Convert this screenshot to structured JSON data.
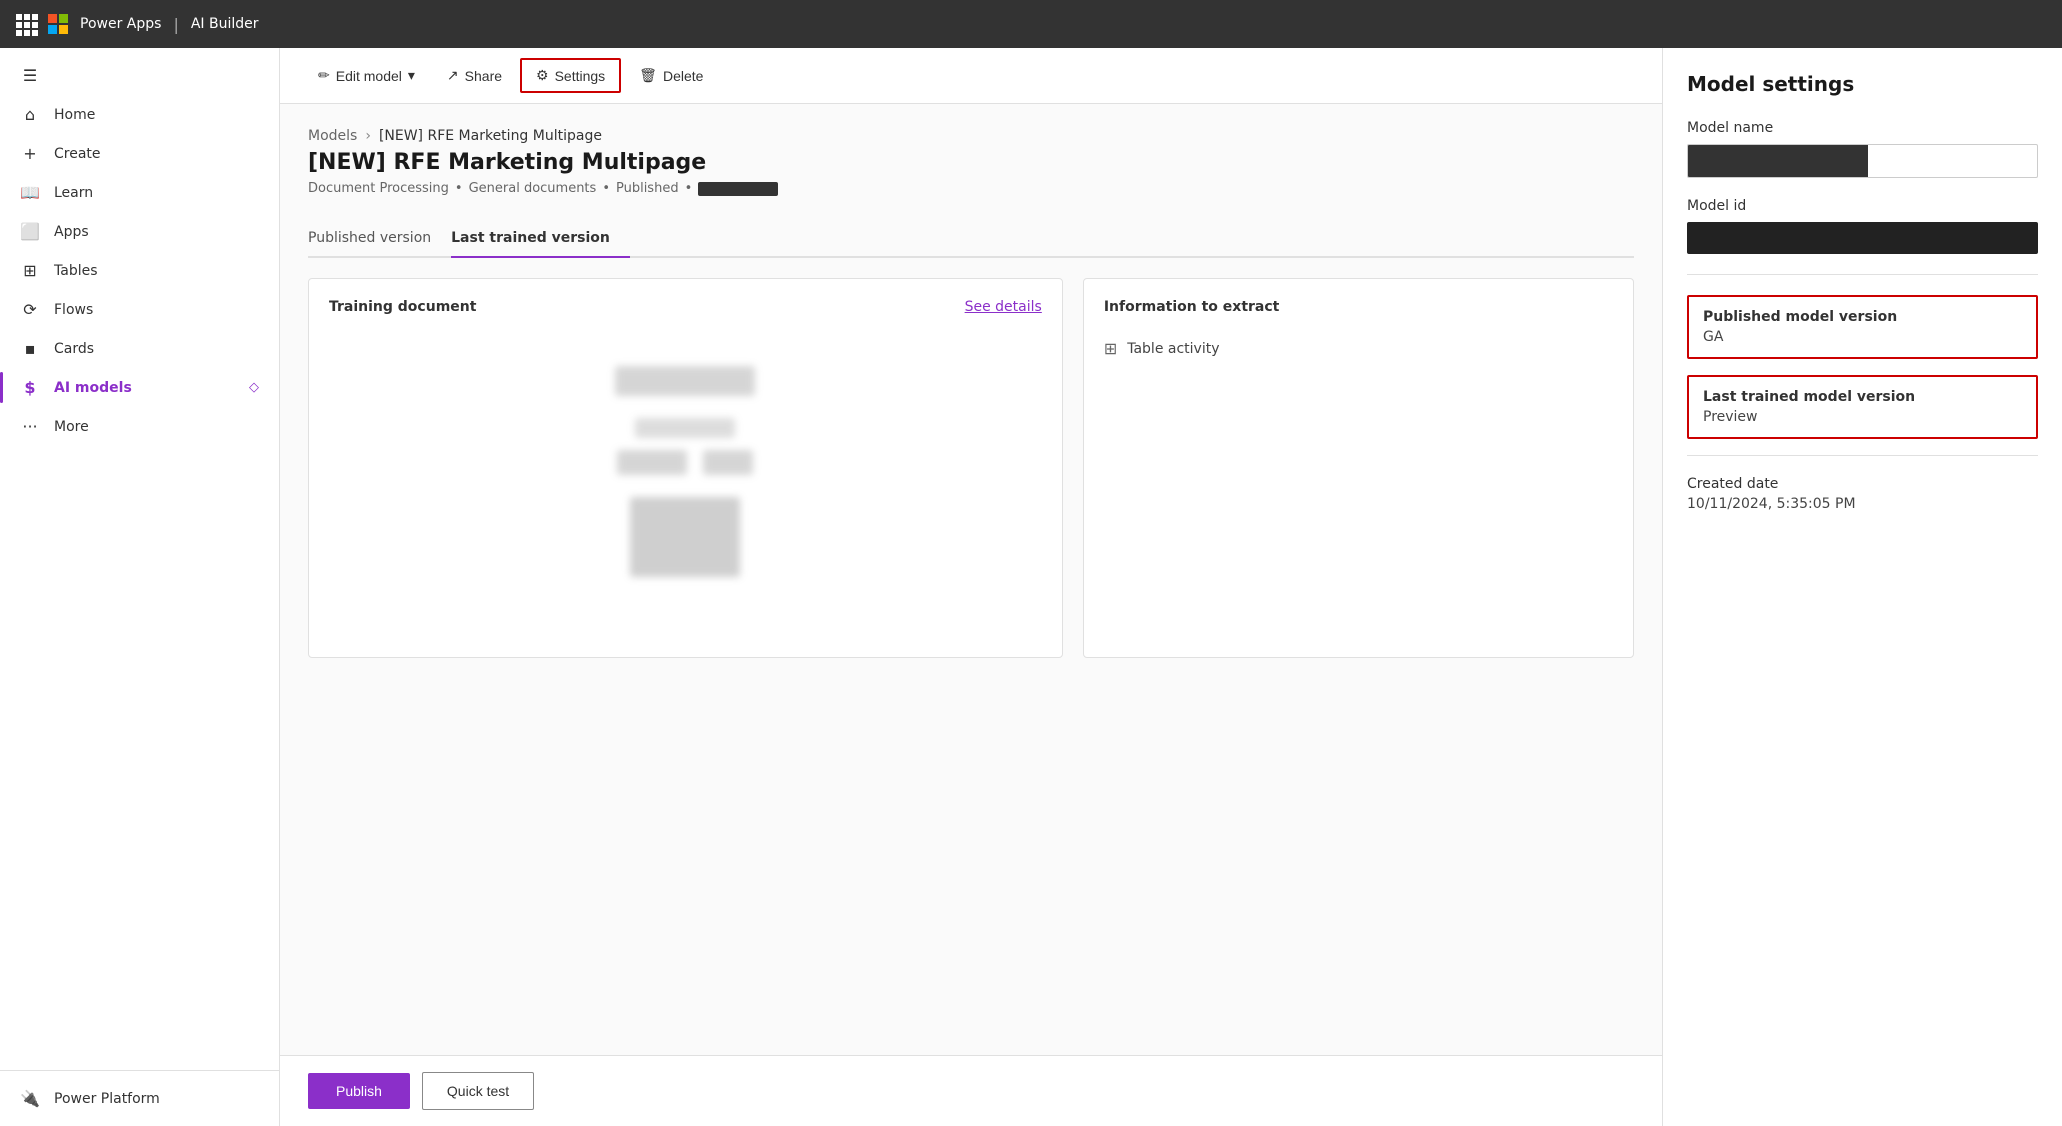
{
  "topbar": {
    "waffle_label": "Apps",
    "ms_logo_alt": "Microsoft logo",
    "brand": "Power Apps",
    "separator": "|",
    "product": "AI Builder"
  },
  "sidebar": {
    "hamburger": "☰",
    "items": [
      {
        "id": "home",
        "label": "Home",
        "icon": "⌂"
      },
      {
        "id": "create",
        "label": "Create",
        "icon": "+"
      },
      {
        "id": "learn",
        "label": "Learn",
        "icon": "📖"
      },
      {
        "id": "apps",
        "label": "Apps",
        "icon": "⬜"
      },
      {
        "id": "tables",
        "label": "Tables",
        "icon": "⊞"
      },
      {
        "id": "flows",
        "label": "Flows",
        "icon": "⟳"
      },
      {
        "id": "cards",
        "label": "Cards",
        "icon": "⬛"
      },
      {
        "id": "ai-models",
        "label": "AI models",
        "icon": "$",
        "active": true
      },
      {
        "id": "more",
        "label": "More",
        "icon": "···"
      }
    ],
    "bottom": [
      {
        "id": "power-platform",
        "label": "Power Platform",
        "icon": "🔌"
      }
    ]
  },
  "toolbar": {
    "edit_model_label": "Edit model",
    "edit_chevron": "▾",
    "share_label": "Share",
    "settings_label": "Settings",
    "delete_label": "Delete",
    "share_icon": "↗",
    "edit_icon": "✏",
    "settings_icon": "⚙",
    "delete_icon": "🗑"
  },
  "breadcrumb": {
    "parent": "Models",
    "separator": "›",
    "current": "[NEW] RFE Marketing Multipage"
  },
  "page": {
    "title": "[NEW] RFE Marketing Multipage",
    "meta": {
      "type": "Document Processing",
      "separator1": "•",
      "scope": "General documents",
      "separator2": "•",
      "status": "Published",
      "separator3": "•"
    }
  },
  "tabs": [
    {
      "id": "published",
      "label": "Published version",
      "active": false
    },
    {
      "id": "last-trained",
      "label": "Last trained version",
      "active": true
    }
  ],
  "training_card": {
    "title": "Training document",
    "link": "See details"
  },
  "info_card": {
    "title": "Information to extract",
    "items": [
      {
        "icon": "⊞",
        "label": "Table activity"
      }
    ]
  },
  "actions": {
    "publish": "Publish",
    "quick_test": "Quick test"
  },
  "settings_panel": {
    "title": "Model settings",
    "model_name_label": "Model name",
    "model_id_label": "Model id",
    "published_model_version_label": "Published model version",
    "published_model_version_value": "GA",
    "last_trained_model_version_label": "Last trained model version",
    "last_trained_model_version_value": "Preview",
    "created_date_label": "Created date",
    "created_date_value": "10/11/2024, 5:35:05 PM"
  }
}
